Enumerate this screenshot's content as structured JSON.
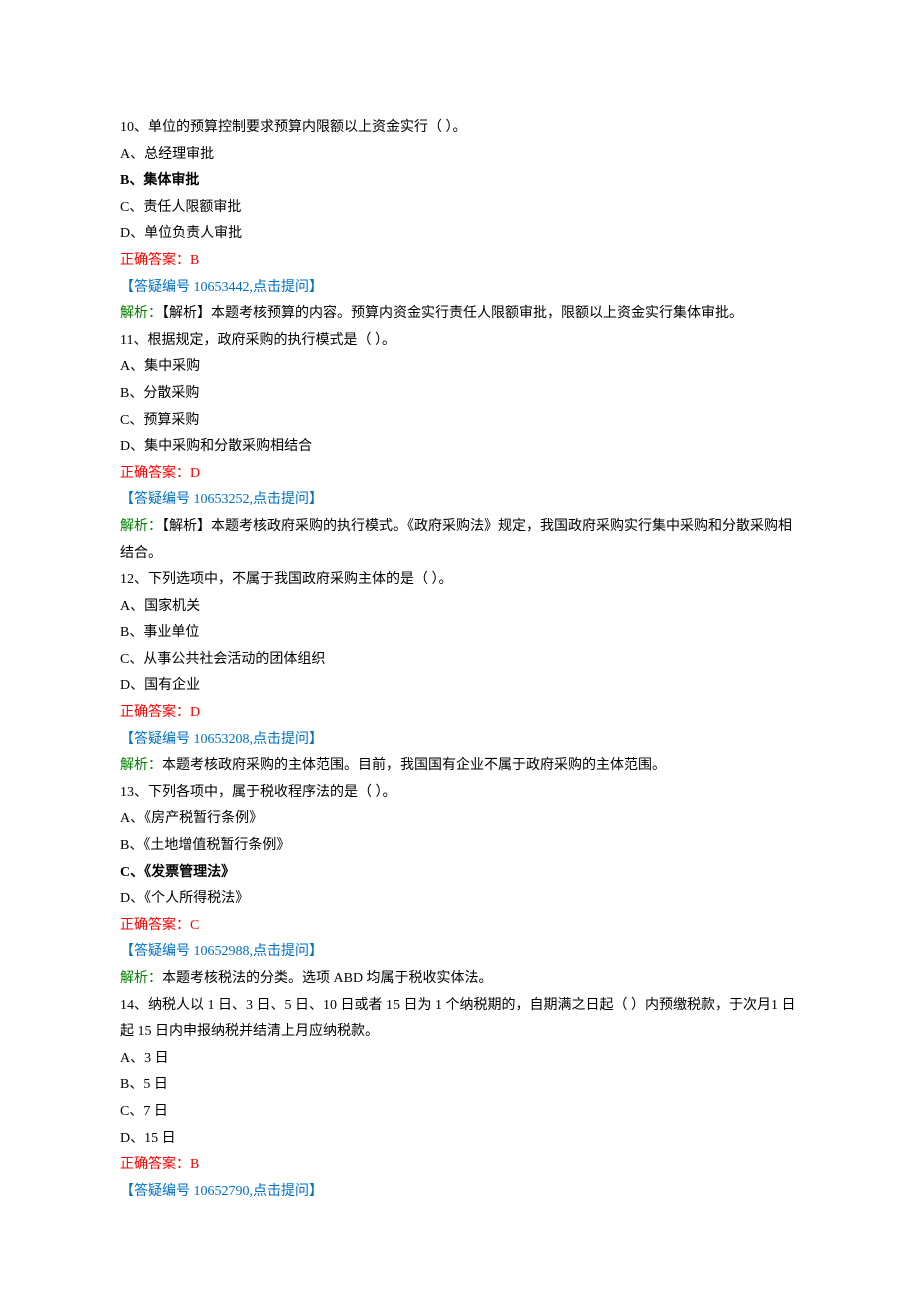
{
  "questions": [
    {
      "number": "10",
      "text": "10、单位的预算控制要求预算内限额以上资金实行（  ）。",
      "options": [
        {
          "text": "A、总经理审批",
          "bold": false
        },
        {
          "text": "B、集体审批",
          "bold": true
        },
        {
          "text": "C、责任人限额审批",
          "bold": false
        },
        {
          "text": "D、单位负责人审批",
          "bold": false
        }
      ],
      "answer": "正确答案：B",
      "link": "【答疑编号 10653442,点击提问】",
      "analysis_label": "解析：",
      "analysis_text": "【解析】本题考核预算的内容。预算内资金实行责任人限额审批，限额以上资金实行集体审批。"
    },
    {
      "number": "11",
      "text": "11、根据规定，政府采购的执行模式是（  ）。",
      "options": [
        {
          "text": "A、集中采购",
          "bold": false
        },
        {
          "text": "B、分散采购",
          "bold": false
        },
        {
          "text": "C、预算采购",
          "bold": false
        },
        {
          "text": "D、集中采购和分散采购相结合",
          "bold": false
        }
      ],
      "answer": "正确答案：D",
      "link": "【答疑编号 10653252,点击提问】",
      "analysis_label": "解析：",
      "analysis_text": "【解析】本题考核政府采购的执行模式。《政府采购法》规定，我国政府采购实行集中采购和分散采购相结合。"
    },
    {
      "number": "12",
      "text": "12、下列选项中，不属于我国政府采购主体的是（  ）。",
      "options": [
        {
          "text": "A、国家机关",
          "bold": false
        },
        {
          "text": "B、事业单位",
          "bold": false
        },
        {
          "text": "C、从事公共社会活动的团体组织",
          "bold": false
        },
        {
          "text": "D、国有企业",
          "bold": false
        }
      ],
      "answer": "正确答案：D",
      "link": "【答疑编号 10653208,点击提问】",
      "analysis_label": "解析：",
      "analysis_text": "本题考核政府采购的主体范围。目前，我国国有企业不属于政府采购的主体范围。"
    },
    {
      "number": "13",
      "text": "13、下列各项中，属于税收程序法的是（  ）。",
      "options": [
        {
          "text": "A、《房产税暂行条例》",
          "bold": false
        },
        {
          "text": "B、《土地增值税暂行条例》",
          "bold": false
        },
        {
          "text": "C、《发票管理法》",
          "bold": true
        },
        {
          "text": "D、《个人所得税法》",
          "bold": false
        }
      ],
      "answer": "正确答案：C",
      "link": "【答疑编号 10652988,点击提问】",
      "analysis_label": "解析：",
      "analysis_text": "本题考核税法的分类。选项 ABD 均属于税收实体法。"
    },
    {
      "number": "14",
      "text": "14、纳税人以 1 日、3 日、5 日、10 日或者 15 日为 1 个纳税期的，自期满之日起（  ）内预缴税款，于次月1 日起 15 日内申报纳税并结清上月应纳税款。",
      "options": [
        {
          "text": "A、3 日",
          "bold": false
        },
        {
          "text": "B、5 日",
          "bold": false
        },
        {
          "text": "C、7 日",
          "bold": false
        },
        {
          "text": "D、15 日",
          "bold": false
        }
      ],
      "answer": "正确答案：B",
      "link": "【答疑编号 10652790,点击提问】",
      "analysis_label": "",
      "analysis_text": ""
    }
  ]
}
